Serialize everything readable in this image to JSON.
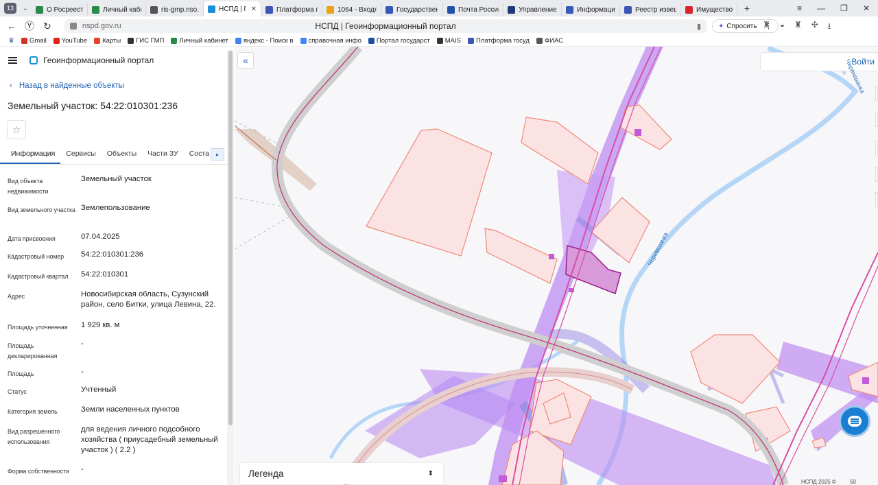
{
  "browser": {
    "tab_count": "13",
    "tabs": [
      {
        "label": "О Росреестр",
        "color": "#2a8a4a"
      },
      {
        "label": "Личный кабин",
        "color": "#2a8a4a"
      },
      {
        "label": "ris-gmp.nso.ru",
        "color": "#555555"
      },
      {
        "label": "НСПД | Гео",
        "color": "#1a8fd6",
        "active": true
      },
      {
        "label": "Платформа го",
        "color": "#3b57b5"
      },
      {
        "label": "1064 - Входящ",
        "color": "#e8a317"
      },
      {
        "label": "Государствен",
        "color": "#3b57b5"
      },
      {
        "label": "Почта России",
        "color": "#2050a8"
      },
      {
        "label": "Управление э",
        "color": "#1f3a7a"
      },
      {
        "label": "Информация",
        "color": "#3b57b5"
      },
      {
        "label": "Реестр извещ",
        "color": "#3b57b5"
      },
      {
        "label": "Имущество",
        "color": "#d3262e"
      }
    ],
    "url": "nspd.gov.ru",
    "page_title": "НСПД | Геоинформационный портал",
    "ask_label": "Спросить",
    "bookmarks": [
      {
        "label": "Gmail",
        "color": "#d93025"
      },
      {
        "label": "YouTube",
        "color": "#e62117"
      },
      {
        "label": "Карты",
        "color": "#e8402a"
      },
      {
        "label": "ГИС ГМП",
        "color": "#333333"
      },
      {
        "label": "Личный кабинет",
        "color": "#2a8a4a"
      },
      {
        "label": "яндекс - Поиск в",
        "color": "#4285f4"
      },
      {
        "label": "справочная инфо",
        "color": "#4285f4"
      },
      {
        "label": "Портал государст",
        "color": "#1f4fa3"
      },
      {
        "label": "MAIS",
        "color": "#333333"
      },
      {
        "label": "Платформа госуд",
        "color": "#3b57b5"
      },
      {
        "label": "ФИАС",
        "color": "#555555"
      }
    ]
  },
  "portal": {
    "name": "Геоинформационный портал",
    "back_link": "Назад в найденные объекты",
    "object_title": "Земельный участок: 54:22:010301:236",
    "tabs": [
      "Информация",
      "Сервисы",
      "Объекты",
      "Части ЗУ",
      "Соста"
    ],
    "properties": [
      {
        "key": "Вид объекта недвижимости",
        "value": "Земельный участок"
      },
      {
        "key": "Вид земельного участка",
        "value": "Землепользование"
      },
      {
        "key": "Дата присвоения",
        "value": "07.04.2025"
      },
      {
        "key": "Кадастровый номер",
        "value": "54:22:010301:236"
      },
      {
        "key": "Кадастровый квартал",
        "value": "54:22:010301"
      },
      {
        "key": "Адрес",
        "value": "Новосибирская область, Сузунский район, село Битки, улица Левина, 22."
      },
      {
        "key": "Площадь уточненная",
        "value": "1 929 кв. м"
      },
      {
        "key": "Площадь декларированная",
        "value": "-"
      },
      {
        "key": "Площадь",
        "value": "-"
      },
      {
        "key": "Статус",
        "value": "Учтенный"
      },
      {
        "key": "Категория земель",
        "value": "Земли населенных пунктов"
      },
      {
        "key": "Вид разрешенного использования",
        "value": "для ведения личного подсобного хозяйства ( приусадебный земельный участок ) ( 2.2 )"
      },
      {
        "key": "Форма собственности",
        "value": "-"
      }
    ]
  },
  "map": {
    "login": "Войти",
    "legend": "Легенда",
    "river_label": "Черемшанка",
    "river_label_2": "Черемшанка",
    "copyright": "НСПД 2025 ©",
    "scale": "50"
  }
}
